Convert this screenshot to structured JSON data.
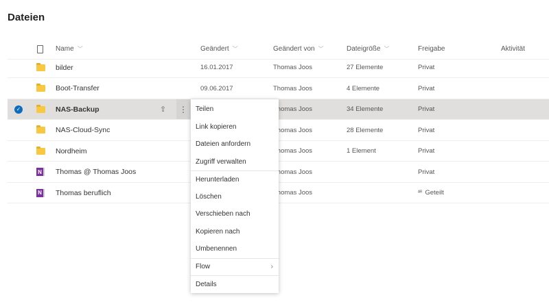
{
  "page_title": "Dateien",
  "columns": {
    "name": "Name",
    "geaendert": "Geändert",
    "geaendert_von": "Geändert von",
    "groesse": "Dateigröße",
    "freigabe": "Freigabe",
    "aktivitaet": "Aktivität"
  },
  "rows": [
    {
      "icon": "folder-icon",
      "name": "bilder",
      "geaendert": "16.01.2017",
      "von": "Thomas Joos",
      "groesse": "27 Elemente",
      "freigabe": "Privat"
    },
    {
      "icon": "folder-icon",
      "name": "Boot-Transfer",
      "geaendert": "09.06.2017",
      "von": "Thomas Joos",
      "groesse": "4 Elemente",
      "freigabe": "Privat"
    },
    {
      "icon": "folder-icon",
      "name": "NAS-Backup",
      "geaendert": "",
      "von": "Thomas Joos",
      "groesse": "34 Elemente",
      "freigabe": "Privat",
      "selected": true
    },
    {
      "icon": "folder-icon",
      "name": "NAS-Cloud-Sync",
      "geaendert": "",
      "von": "Thomas Joos",
      "groesse": "28 Elemente",
      "freigabe": "Privat"
    },
    {
      "icon": "folder-icon",
      "name": "Nordheim",
      "geaendert": "",
      "von": "Thomas Joos",
      "groesse": "1 Element",
      "freigabe": "Privat"
    },
    {
      "icon": "onenote-icon",
      "name": "Thomas @ Thomas Joos",
      "geaendert": "",
      "von": "Thomas Joos",
      "groesse": "",
      "freigabe": "Privat"
    },
    {
      "icon": "onenote-icon",
      "name": "Thomas beruflich",
      "geaendert": "",
      "von": "Thomas Joos",
      "groesse": "",
      "freigabe": "Geteilt"
    }
  ],
  "context_menu": [
    "Teilen",
    "Link kopieren",
    "Dateien anfordern",
    "Zugriff verwalten",
    "Herunterladen",
    "Löschen",
    "Verschieben nach",
    "Kopieren nach",
    "Umbenennen",
    "Flow",
    "Details"
  ]
}
